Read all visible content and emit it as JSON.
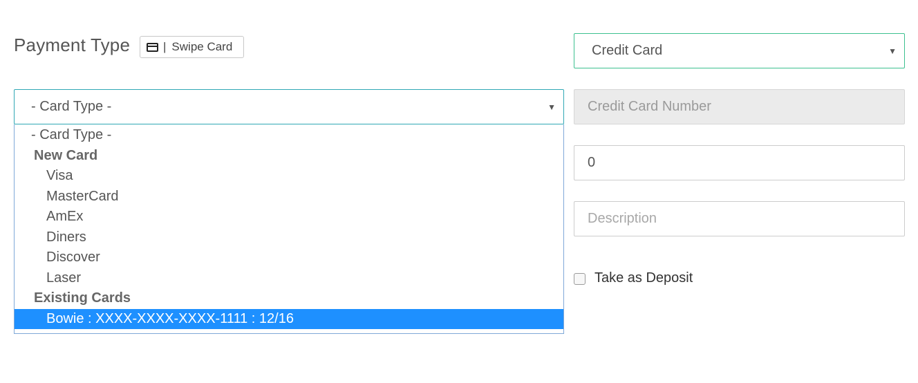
{
  "payment": {
    "title": "Payment Type",
    "swipe_label": "Swipe Card",
    "swipe_separator": "|",
    "type_value": "Credit Card"
  },
  "card_type": {
    "value": "- Card Type -",
    "options": [
      {
        "kind": "top",
        "label": "- Card Type -"
      },
      {
        "kind": "group",
        "label": "New Card"
      },
      {
        "kind": "option",
        "label": "Visa"
      },
      {
        "kind": "option",
        "label": "MasterCard"
      },
      {
        "kind": "option",
        "label": "AmEx"
      },
      {
        "kind": "option",
        "label": "Diners"
      },
      {
        "kind": "option",
        "label": "Discover"
      },
      {
        "kind": "option",
        "label": "Laser"
      },
      {
        "kind": "group",
        "label": "Existing Cards"
      },
      {
        "kind": "option",
        "label": "Bowie : XXXX-XXXX-XXXX-1111 : 12/16",
        "selected": true
      }
    ]
  },
  "credit_card_number": {
    "placeholder": "Credit Card Number"
  },
  "amount": {
    "value": "0"
  },
  "description": {
    "placeholder": "Description"
  },
  "deposit": {
    "label": "Take as Deposit",
    "checked": false
  },
  "colors": {
    "accent_green": "#3cc08f",
    "highlight_blue": "#1e90ff",
    "disabled_gray": "#ebebeb"
  },
  "icons": {
    "swipe": "credit-card-icon",
    "select_caret": "caret-down-icon"
  }
}
